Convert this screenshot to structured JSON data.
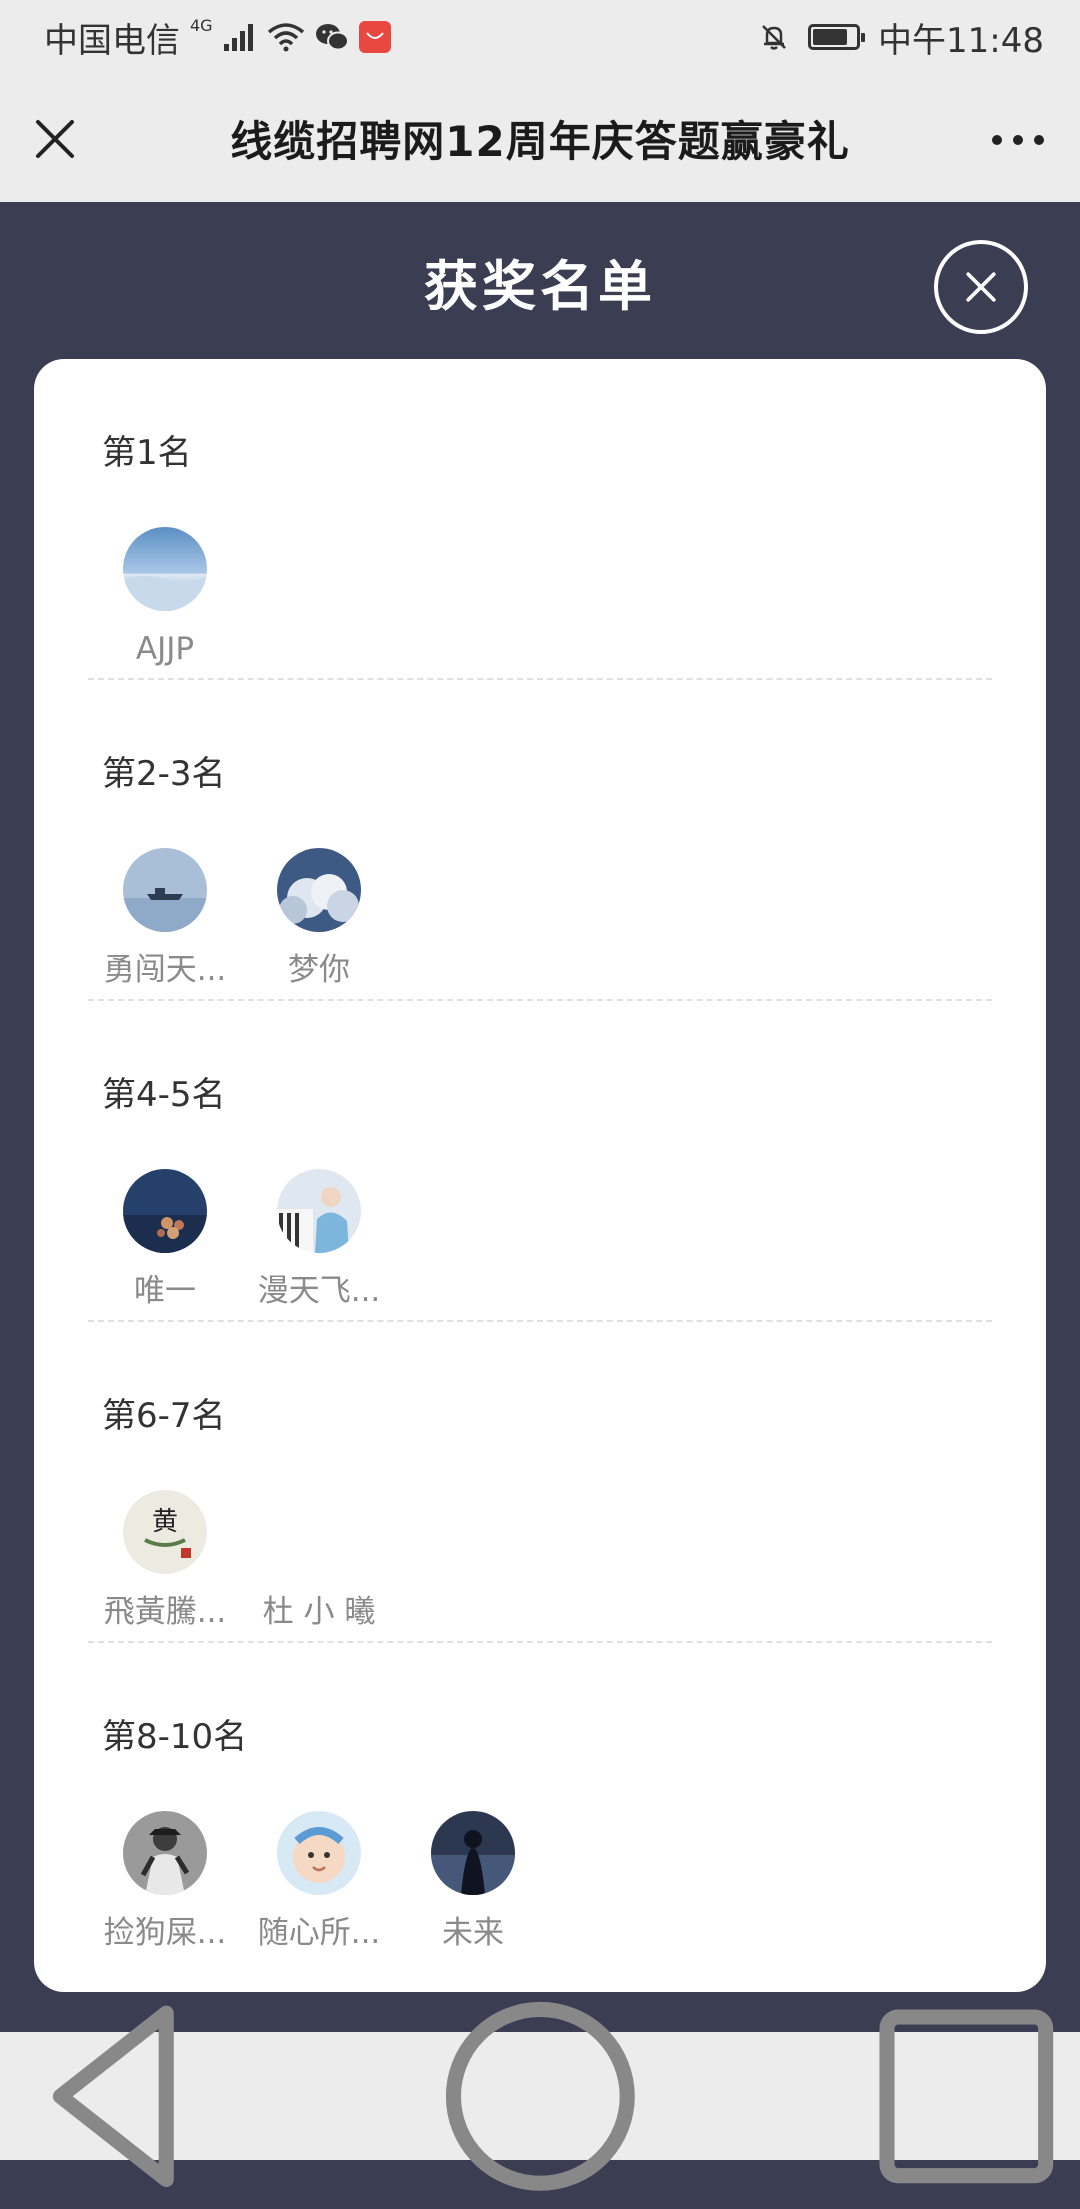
{
  "status_bar": {
    "carrier": "中国电信",
    "network": "4G",
    "time": "中午11:48",
    "battery_level": 0.8
  },
  "nav": {
    "title": "线缆招聘网12周年庆答题赢豪礼"
  },
  "modal": {
    "title": "获奖名单"
  },
  "sections": [
    {
      "rank": "第1名",
      "winners": [
        {
          "name": "AJJP",
          "avatar": "snowy-landscape"
        }
      ]
    },
    {
      "rank": "第2-3名",
      "winners": [
        {
          "name": "勇闯天...",
          "avatar": "boat-on-sea"
        },
        {
          "name": "梦你",
          "avatar": "clouds-sky"
        }
      ]
    },
    {
      "rank": "第4-5名",
      "winners": [
        {
          "name": "唯一",
          "avatar": "bokeh-lights"
        },
        {
          "name": "漫天飞...",
          "avatar": "girl-piano"
        }
      ]
    },
    {
      "rank": "第6-7名",
      "winners": [
        {
          "name": "飛黃騰...",
          "avatar": "calligraphy-seal"
        },
        {
          "name": "杜 小 曦",
          "avatar": ""
        }
      ]
    },
    {
      "rank": "第8-10名",
      "winners": [
        {
          "name": "捡狗屎...",
          "avatar": "bw-person"
        },
        {
          "name": "随心所...",
          "avatar": "baby-face"
        },
        {
          "name": "未来",
          "avatar": "dark-figure"
        }
      ]
    }
  ],
  "colors": {
    "modal_background": "#3b3e52",
    "card_background": "#ffffff",
    "nav_background": "#ececec"
  }
}
